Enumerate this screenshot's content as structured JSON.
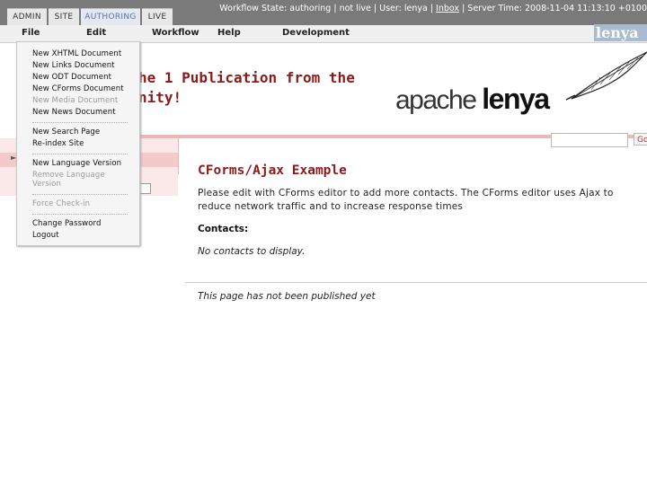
{
  "tabs": [
    "ADMIN",
    "SITE",
    "AUTHORING",
    "LIVE"
  ],
  "status": {
    "workflow": "Workflow State: authoring",
    "live": "not live",
    "user": "User: lenya",
    "inbox": "Inbox",
    "server_time": "Server Time: 2008-11-04 11:13:10 +0100"
  },
  "menubar": [
    "File",
    "Edit",
    "Workflow",
    "Help",
    "Development"
  ],
  "logo_mini": "lenya",
  "file_menu": {
    "items": [
      {
        "label": "New XHTML Document",
        "enabled": true
      },
      {
        "label": "New Links Document",
        "enabled": true
      },
      {
        "label": "New ODT Document",
        "enabled": true
      },
      {
        "label": "New CForms Document",
        "enabled": true
      },
      {
        "label": "New Media Document",
        "enabled": false
      },
      {
        "label": "New News Document",
        "enabled": true
      },
      {
        "label": "New Search Page",
        "enabled": true
      },
      {
        "label": "Re-index Site",
        "enabled": true
      },
      {
        "label": "New Language Version",
        "enabled": true
      },
      {
        "label": "Remove Language Version",
        "enabled": false
      },
      {
        "label": "Force Check-in",
        "enabled": false
      },
      {
        "label": "Change Password",
        "enabled": true
      },
      {
        "label": "Logout",
        "enabled": true
      }
    ]
  },
  "header": {
    "headline_line1": "he 1 Publication from the",
    "headline_line2": "nity!",
    "brand_regular": "apache ",
    "brand_bold": "lenya"
  },
  "search": {
    "button_label": "Go"
  },
  "content": {
    "title": "CForms/Ajax Example",
    "paragraph": "Please edit with CForms editor to add more contacts. The CForms editor uses Ajax to reduce network traffic and to increase response times",
    "contacts_label": "Contacts:",
    "no_contacts": "No contacts to display.",
    "not_published": "This page has not been published yet"
  },
  "colors": {
    "accent": "#8b1b1b",
    "toolbar": "#7a7a7a",
    "pink": "#e8b7b7"
  }
}
